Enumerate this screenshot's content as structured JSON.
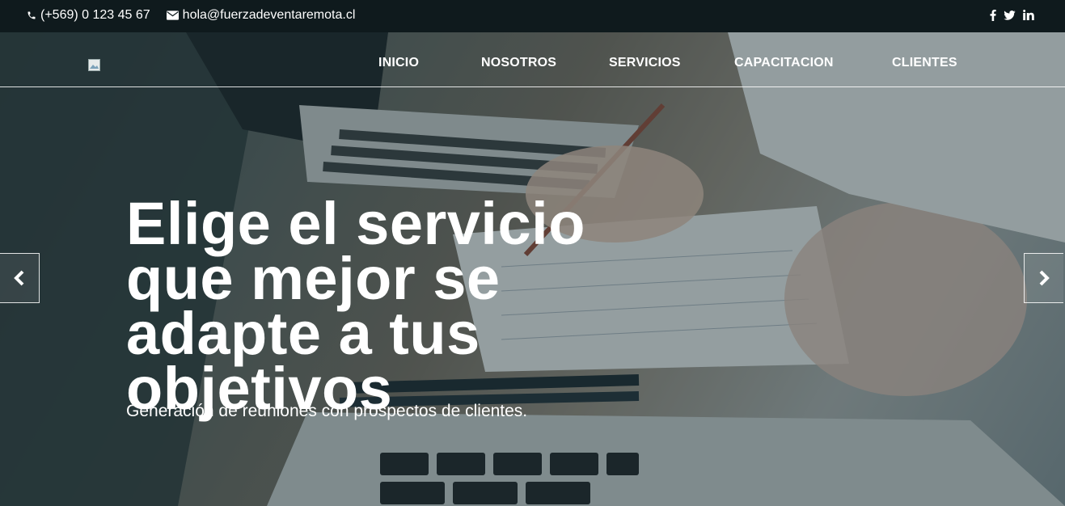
{
  "topbar": {
    "phone": "(+569) 0 123 45 67",
    "email": "hola@fuerzadeventaremota.cl",
    "social": [
      "f",
      "twitter",
      "in"
    ],
    "phone_icon": "phone-icon",
    "email_icon": "envelope-icon"
  },
  "nav": {
    "items": [
      {
        "label": "INICIO"
      },
      {
        "label": "NOSOTROS"
      },
      {
        "label": "SERVICIOS"
      },
      {
        "label": "CAPACITACION"
      },
      {
        "label": "CLIENTES"
      }
    ]
  },
  "hero": {
    "headline": "Elige el servicio que mejor se adapte a tus objetivos",
    "subtitle": "Generación de reuniones con prospectos de clientes.",
    "prev_icon": "chevron-left-icon",
    "next_icon": "chevron-right-icon"
  },
  "colors": {
    "topbar_bg": "#0f1a1d",
    "text": "#ffffff"
  }
}
